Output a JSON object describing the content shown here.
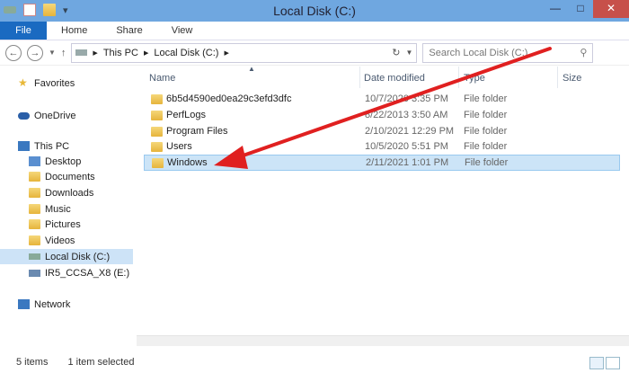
{
  "window": {
    "title": "Local Disk (C:)"
  },
  "ribbon": {
    "tabs": [
      "File",
      "Home",
      "Share",
      "View"
    ]
  },
  "address": {
    "crumbs": [
      "This PC",
      "Local Disk (C:)"
    ],
    "search_placeholder": "Search Local Disk (C:)"
  },
  "sidebar": {
    "items": [
      "Favorites",
      "OneDrive",
      "This PC",
      "Desktop",
      "Documents",
      "Downloads",
      "Music",
      "Pictures",
      "Videos",
      "Local Disk (C:)",
      "IR5_CCSA_X8 (E:)",
      "Network"
    ]
  },
  "columns": [
    "Name",
    "Date modified",
    "Type",
    "Size"
  ],
  "files": [
    {
      "name": "6b5d4590ed0ea29c3efd3dfc",
      "date": "10/7/2020 3:35 PM",
      "type": "File folder"
    },
    {
      "name": "PerfLogs",
      "date": "8/22/2013 3:50 AM",
      "type": "File folder"
    },
    {
      "name": "Program Files",
      "date": "2/10/2021 12:29 PM",
      "type": "File folder"
    },
    {
      "name": "Users",
      "date": "10/5/2020 5:51 PM",
      "type": "File folder"
    },
    {
      "name": "Windows",
      "date": "2/11/2021 1:01 PM",
      "type": "File folder"
    }
  ],
  "status": {
    "count": "5 items",
    "selected": "1 item selected"
  },
  "colors": {
    "accent": "#1a6ac1",
    "arrow": "#e02020",
    "selection": "#cce4f7"
  }
}
